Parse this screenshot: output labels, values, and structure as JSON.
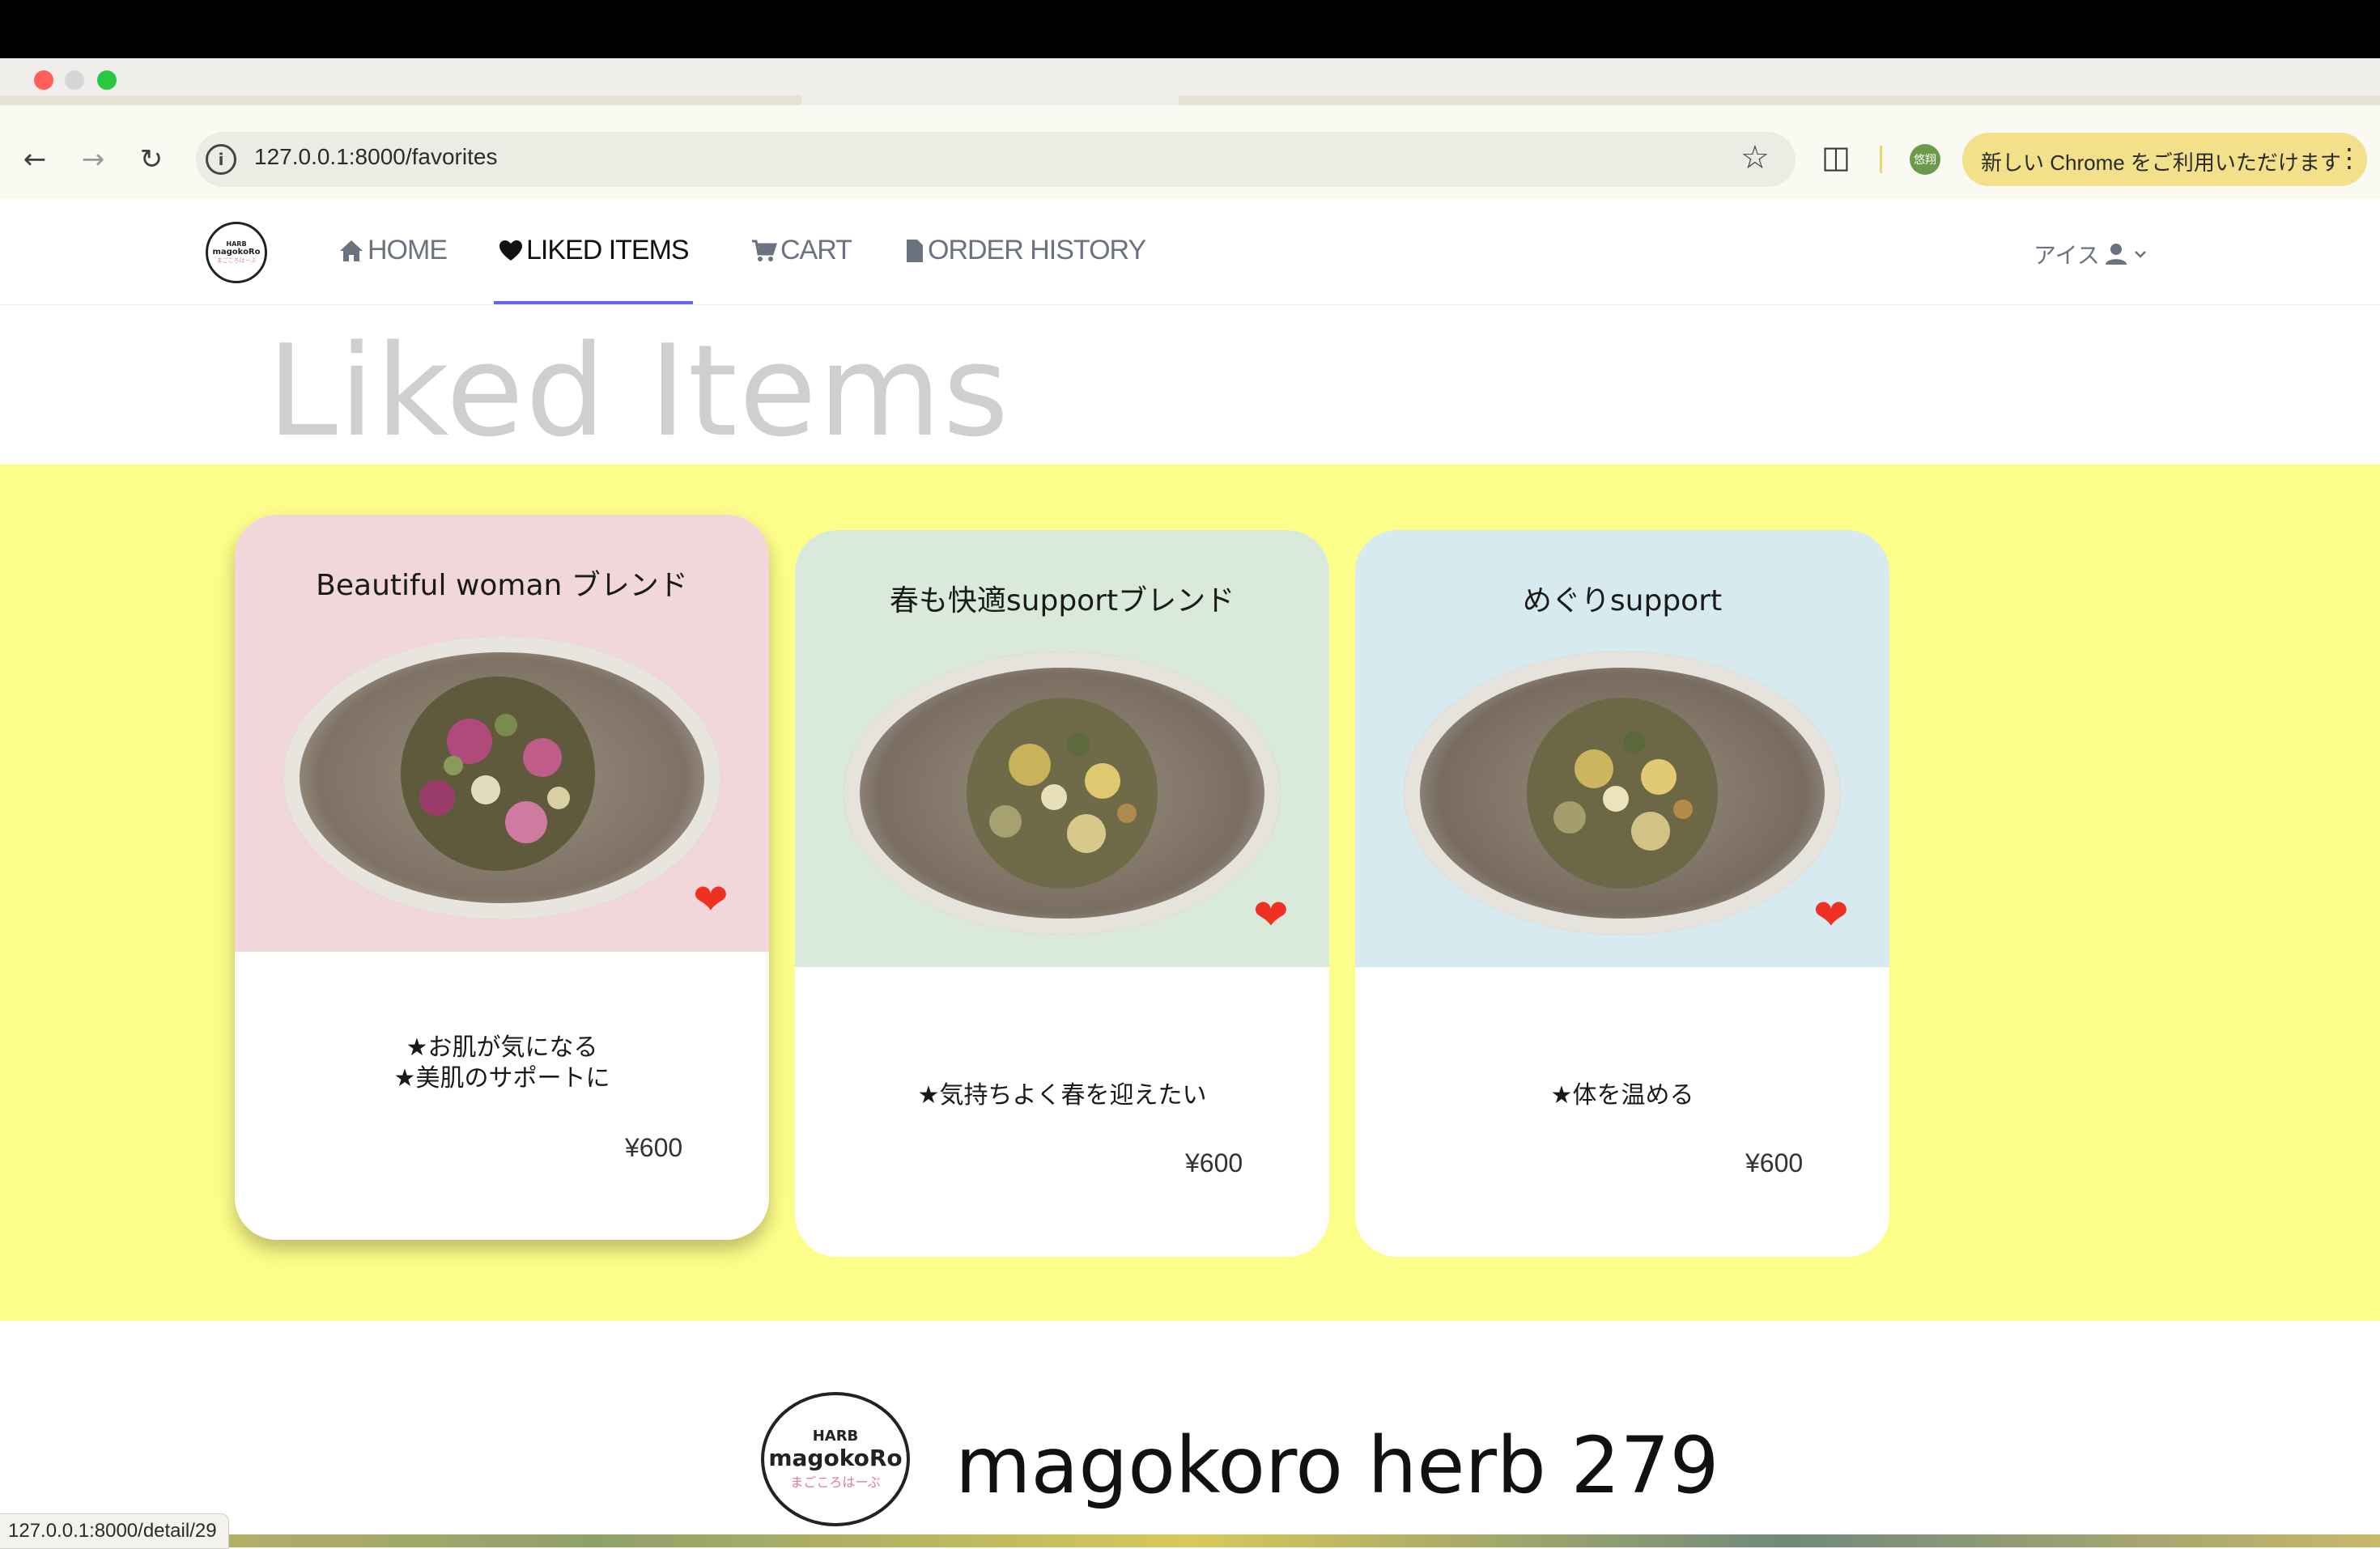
{
  "browser": {
    "url": "127.0.0.1:8000/favorites",
    "promo_text": "新しい Chrome をご利用いただけます",
    "profile_label": "悠翔",
    "status_url": "127.0.0.1:8000/detail/29",
    "colors": {
      "close": "#ff5f57",
      "minimize": "#d6d6d6",
      "zoom": "#28c840"
    }
  },
  "site": {
    "logo": {
      "top": "HARB",
      "word": "magokoRo",
      "sub": "まごころはーぶ"
    },
    "nav": {
      "home": "HOME",
      "liked": "LIKED ITEMS",
      "cart": "CART",
      "history": "ORDER HISTORY"
    },
    "user_name": "アイス",
    "page_title": "Liked Items"
  },
  "items": [
    {
      "name": "Beautiful woman ブレンド",
      "desc1": "★お肌が気になる",
      "desc2": "★美肌のサポートに",
      "price": "¥600",
      "bg": "#f2d7da",
      "liked": true
    },
    {
      "name": "春も快適supportブレンド",
      "desc1": "★気持ちよく春を迎えたい",
      "desc2": "",
      "price": "¥600",
      "bg": "#d9eadb",
      "liked": true
    },
    {
      "name": "めぐりsupport",
      "desc1": "★体を温める",
      "desc2": "",
      "price": "¥600",
      "bg": "#d6eaef",
      "liked": true
    }
  ],
  "footer": {
    "brand": "magokoro herb 279"
  }
}
